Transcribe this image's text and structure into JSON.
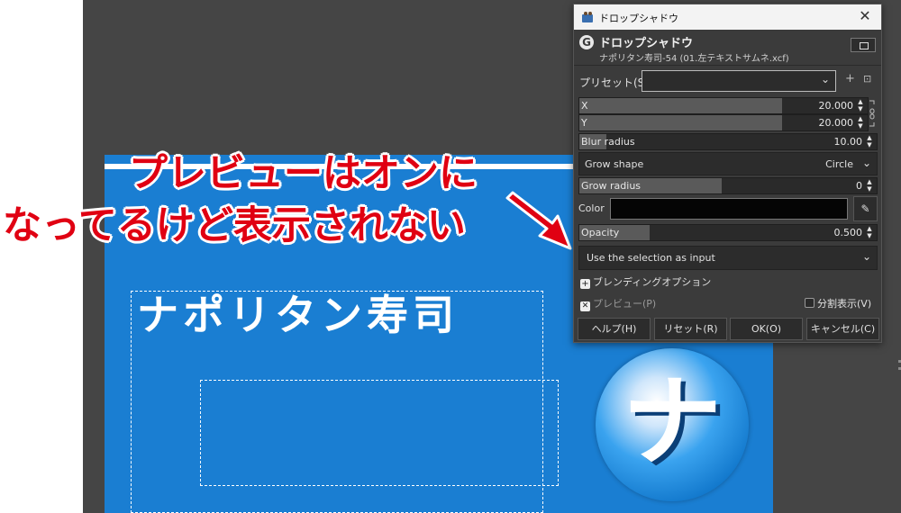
{
  "annotation": {
    "line1": "プレビューはオンに",
    "line2": "なってるけど表示されない"
  },
  "canvas": {
    "image_title": "ナポリタン寿司",
    "logo_char": "ナ"
  },
  "dialog": {
    "window_title": "ドロップシャドウ",
    "header_title": "ドロップシャドウ",
    "header_subtitle": "ナポリタン寿司-54 (01.左テキストサムネ.xcf)",
    "preset_label": "プリセット(S):",
    "preset_value": "",
    "fields": {
      "x": {
        "label": "X",
        "value": "20.000"
      },
      "y": {
        "label": "Y",
        "value": "20.000"
      },
      "blur": {
        "label": "Blur radius",
        "value": "10.00"
      },
      "grow_shape": {
        "label": "Grow shape",
        "value": "Circle"
      },
      "grow_radius": {
        "label": "Grow radius",
        "value": "0"
      },
      "color": {
        "label": "Color",
        "value": "#050505"
      },
      "opacity": {
        "label": "Opacity",
        "value": "0.500",
        "fraction": 0.5
      },
      "input_mode": {
        "value": "Use the selection as input"
      }
    },
    "blending_options": "ブレンディングオプション",
    "preview_label": "プレビュー(P)",
    "split_view_label": "分割表示(V)",
    "buttons": {
      "help": "ヘルプ(H)",
      "reset": "リセット(R)",
      "ok": "OK(O)",
      "cancel": "キャンセル(C)"
    }
  },
  "colors": {
    "canvas_bg": "#454545",
    "image_blue": "#1a7ed2",
    "annotation_red": "#e00012",
    "dialog_bg": "#3b3b3b"
  }
}
